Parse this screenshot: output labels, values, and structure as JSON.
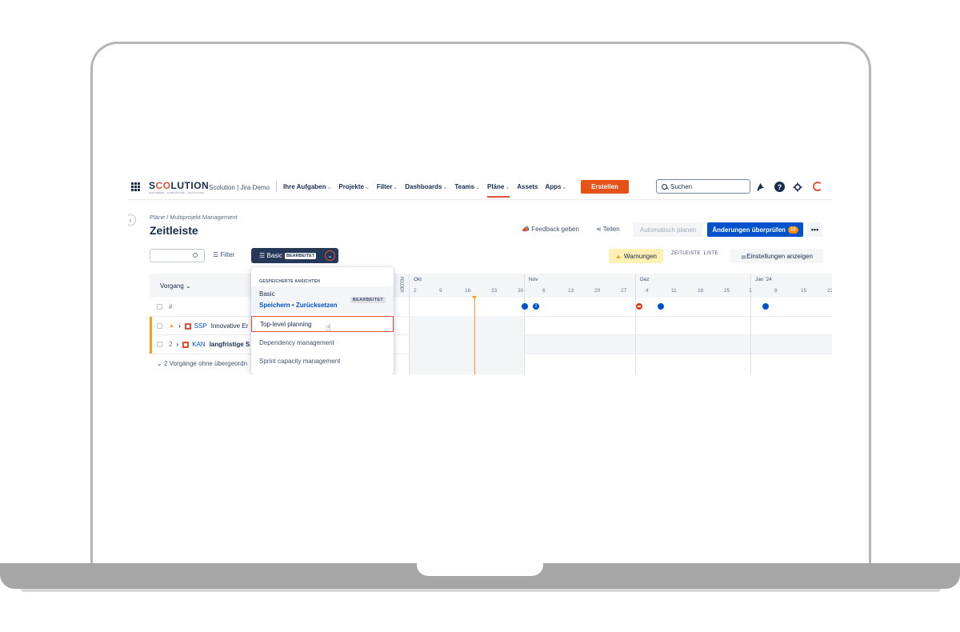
{
  "nav": {
    "logo_prefix": "S",
    "logo_o1": "C",
    "logo_o2": "O",
    "logo_rest": "LUTION",
    "logo_sub": "SOFTWARE · CONSULTING · SOLUTIONS",
    "site": "Scolution | Jira Demo",
    "items": [
      {
        "label": "Ihre Aufgaben",
        "chev": "⌄"
      },
      {
        "label": "Projekte",
        "chev": "⌄"
      },
      {
        "label": "Filter",
        "chev": "⌄"
      },
      {
        "label": "Dashboards",
        "chev": "⌄"
      },
      {
        "label": "Teams",
        "chev": "⌄"
      },
      {
        "label": "Pläne",
        "chev": "⌄"
      },
      {
        "label": "Assets",
        "chev": ""
      },
      {
        "label": "Apps",
        "chev": "⌄"
      }
    ],
    "create": "Erstellen",
    "search_placeholder": "Suchen",
    "accent": "#e0533a"
  },
  "header": {
    "breadcrumb": "Pläne  /  Multiprojekt Management",
    "title": "Zeitleiste",
    "feedback": "Feedback geben",
    "share": "Teilen",
    "auto_plan": "Automatisch planen",
    "review": "Änderungen überprüfen",
    "review_count": "13",
    "more": "•••"
  },
  "toolbar": {
    "filter": "Filter",
    "view": "Basic",
    "view_tag": "BEARBEITET",
    "warnings": "Warnungen",
    "seg_timeline": "ZEITLEISTE",
    "seg_list": "LISTE",
    "settings": "Einstellungen anzeigen"
  },
  "table": {
    "column": "Vorgang",
    "hash": "#",
    "felder": "FELDER",
    "rows": [
      {
        "num": "",
        "key": "SSP",
        "title": "Innovative Er"
      },
      {
        "num": "2",
        "key": "KAN",
        "title": "langfristige S"
      }
    ],
    "ungrouped": "2 Vorgänge ohne übergeordn"
  },
  "timeline": {
    "months": [
      {
        "label": "Okt"
      },
      {
        "label": "Nov"
      },
      {
        "label": "Dez"
      },
      {
        "label": "Jan '24"
      }
    ],
    "days": [
      "2",
      "9",
      "16",
      "23",
      "30",
      "6",
      "13",
      "20",
      "27",
      "4",
      "11",
      "18",
      "25",
      "1",
      "8",
      "15",
      "22"
    ],
    "dot_badge": "2"
  },
  "dropdown": {
    "section": "GESPEICHERTE ANSICHTEN",
    "current": "Basic",
    "save": "Speichern",
    "dot": "•",
    "reset": "Zurücksetzen",
    "tag": "BEARBEITET",
    "items": [
      "Top-level planning",
      "Dependency management",
      "Sprint capacity management"
    ]
  }
}
